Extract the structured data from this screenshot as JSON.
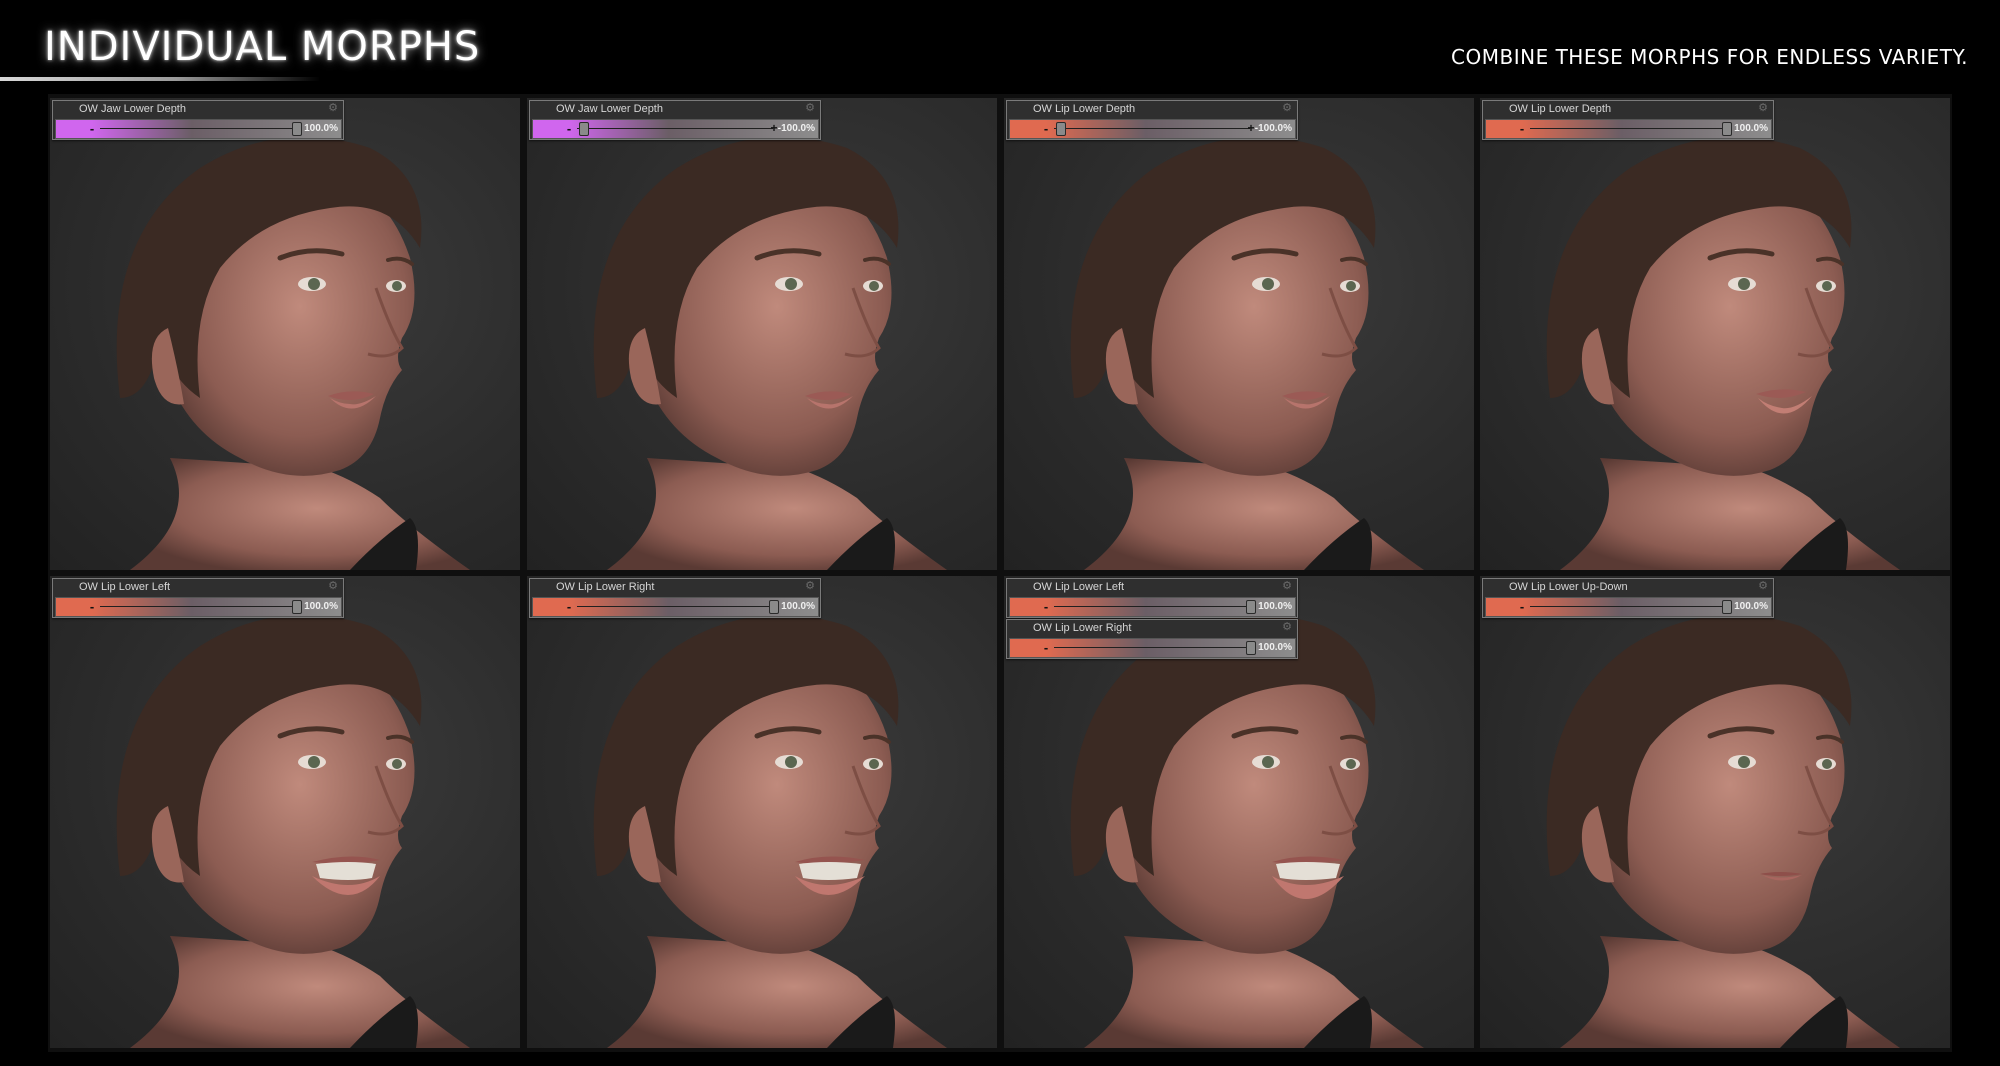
{
  "header": {
    "title": "INDIVIDUAL MORPHS",
    "subtitle": "COMBINE THESE MORPHS FOR ENDLESS VARIETY."
  },
  "colors": {
    "jaw_accent": "#d066ee",
    "lip_accent": "#e06a50",
    "panel_bg": "#2e2e2e",
    "frame_bg": "#0f0f0f"
  },
  "panels": [
    {
      "name": "panel-jaw-lower-depth-pos",
      "expression": "neutral",
      "controls": [
        {
          "label": "OW Jaw Lower Depth",
          "value": "100.0%",
          "level": 1.0,
          "accent": "jaw"
        }
      ]
    },
    {
      "name": "panel-jaw-lower-depth-neg",
      "expression": "neutral",
      "controls": [
        {
          "label": "OW Jaw Lower Depth",
          "value": "-100.0%",
          "level": -1.0,
          "accent": "jaw"
        }
      ]
    },
    {
      "name": "panel-lip-lower-depth-neg",
      "expression": "neutral",
      "controls": [
        {
          "label": "OW Lip Lower Depth",
          "value": "-100.0%",
          "level": -1.0,
          "accent": "lip"
        }
      ]
    },
    {
      "name": "panel-lip-lower-depth-pos",
      "expression": "pout",
      "controls": [
        {
          "label": "OW Lip Lower Depth",
          "value": "100.0%",
          "level": 1.0,
          "accent": "lip"
        }
      ]
    },
    {
      "name": "panel-lip-lower-left",
      "expression": "teeth-left",
      "controls": [
        {
          "label": "OW Lip Lower Left",
          "value": "100.0%",
          "level": 1.0,
          "accent": "lip"
        }
      ]
    },
    {
      "name": "panel-lip-lower-right",
      "expression": "teeth-right",
      "controls": [
        {
          "label": "OW Lip Lower Right",
          "value": "100.0%",
          "level": 1.0,
          "accent": "lip"
        }
      ]
    },
    {
      "name": "panel-lip-lower-left-right",
      "expression": "teeth-wide",
      "controls": [
        {
          "label": "OW Lip Lower Left",
          "value": "100.0%",
          "level": 1.0,
          "accent": "lip"
        },
        {
          "label": "OW Lip Lower Right",
          "value": "100.0%",
          "level": 1.0,
          "accent": "lip"
        }
      ]
    },
    {
      "name": "panel-lip-lower-up-down",
      "expression": "flat",
      "controls": [
        {
          "label": "OW Lip Lower Up-Down",
          "value": "100.0%",
          "level": 1.0,
          "accent": "lip"
        }
      ]
    }
  ]
}
